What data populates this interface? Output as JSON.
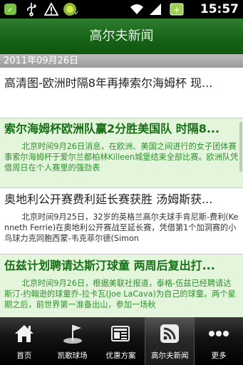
{
  "status_bar": {
    "time": "15:57",
    "icons": [
      "notification-app-icon",
      "usb-icon",
      "warning-icon",
      "notification-app-icon-2",
      "wifi-icon",
      "signal-icon",
      "battery-icon"
    ]
  },
  "header": {
    "title": "高尔夫新闻"
  },
  "news": {
    "date": "2011年09月26日",
    "items": [
      {
        "title": "高清图-欧洲时隔8年再捧索尔海姆杯 现...",
        "summary": ""
      },
      {
        "title": "索尔海姆杯欧洲队赢2分胜美国队 时隔8...",
        "summary": "北京时间9月26日消息，在欧洲、美国之间进行的女子团体赛事索尔海姆杯于爱尔兰都柏林Killeen城堡结束全部比赛。欧洲队凭借周日在个人赛里的强劲表"
      },
      {
        "title": "奥地利公开赛费利延长赛获胜 汤姆斯获...",
        "summary": "北京时间9月25日，32岁的英格兰高尔夫球手肯尼斯-费利(Kenneth Ferrie)在奥地利公开赛战至延长赛，凭借第1个加洞赛的小鸟球力克同胞西蒙-韦克菲尔德(Simon"
      },
      {
        "title": "伍兹计划聘请达斯汀球童 两周后复出打...",
        "summary": "北京时间9月26日，根据美联社报道，泰格-伍兹已经聘请达斯汀-约翰逊的球童乔-拉卡瓦(Joe LaCava)为自己的球童。两个星期之后，前世界第一准备出山，参加一场秋"
      }
    ]
  },
  "tabs": [
    {
      "label": "首页",
      "icon": "home-icon"
    },
    {
      "label": "凯歌球场",
      "icon": "golf-course-icon"
    },
    {
      "label": "优惠方案",
      "icon": "newspaper-icon"
    },
    {
      "label": "高尔夫新闻",
      "icon": "rss-icon",
      "active": true
    },
    {
      "label": "更多",
      "icon": "more-icon"
    }
  ],
  "colors": {
    "accent": "#186418",
    "highlight_bg": "#e3f5da",
    "highlight_text": "#176e17"
  }
}
